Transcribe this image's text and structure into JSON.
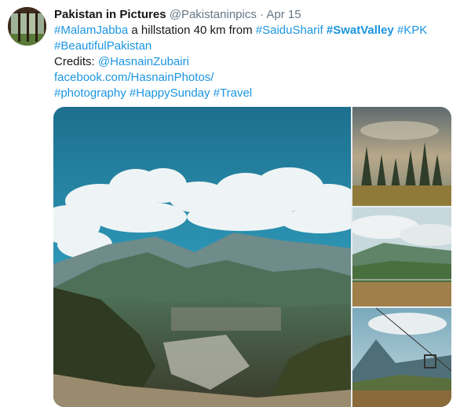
{
  "tweet": {
    "display_name": "Pakistan in Pictures",
    "handle": "@Pakistaninpics",
    "separator": "·",
    "date": "Apr 15",
    "line1": {
      "tag1": "#MalamJabba",
      "text1": " a hillstation 40 km from ",
      "tag2": "#SaiduSharif",
      "tag3": "#SwatValley",
      "tag4": "#KPK"
    },
    "line2": {
      "tag1": "#BeautifulPakistan"
    },
    "line3": {
      "prefix": "Credits: ",
      "mention": "@HasnainZubairi"
    },
    "line4": {
      "link": "facebook.com/HasnainPhotos/"
    },
    "line5": {
      "tag1": "#photography",
      "tag2": "#HappySunday",
      "tag3": "#Travel"
    }
  },
  "colors": {
    "link": "#1b95e0",
    "text": "#14171a",
    "meta": "#657786"
  },
  "media": {
    "photos": [
      "main-valley-photo",
      "pine-trees-photo",
      "green-hills-photo",
      "chairlift-photo"
    ]
  }
}
